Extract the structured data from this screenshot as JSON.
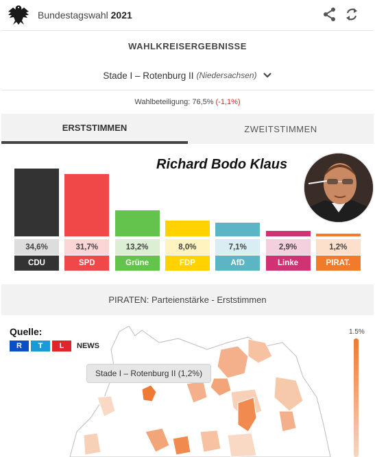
{
  "header": {
    "title_prefix": "Bundestagswahl",
    "title_year": "2021",
    "logo_icon": "federal-eagle-icon",
    "share_icon": "share-icon",
    "refresh_icon": "refresh-icon"
  },
  "section": {
    "title": "WAHLKREISERGEBNISSE"
  },
  "district": {
    "name": "Stade I – Rotenburg II",
    "state": "(Niedersachsen)",
    "dropdown_icon": "chevron-down-icon"
  },
  "turnout": {
    "label": "Wahlbeteiligung: 76,5%",
    "change": "(-1,1%)",
    "change_color": "#d22222"
  },
  "tabs": [
    {
      "label": "ERSTSTIMMEN",
      "active": true
    },
    {
      "label": "ZWEITSTIMMEN",
      "active": false
    }
  ],
  "overlay": {
    "name": "Richard Bodo Klaus",
    "photo_icon": "candidate-portrait"
  },
  "chart_data": {
    "type": "bar",
    "categories": [
      "CDU",
      "SPD",
      "Grüne",
      "FDP",
      "AfD",
      "Linke",
      "PIRAT."
    ],
    "values": [
      34.6,
      31.7,
      13.2,
      8.0,
      7.1,
      2.9,
      1.2
    ],
    "value_labels": [
      "34,6%",
      "31,7%",
      "13,2%",
      "8,0%",
      "7,1%",
      "2,9%",
      "1,2%"
    ],
    "colors": [
      "#333333",
      "#f04848",
      "#63c34c",
      "#ffd200",
      "#5bb5c5",
      "#d13274",
      "#f17a2b"
    ],
    "value_bg": [
      "#dddddd",
      "#fcd6d6",
      "#dcefd5",
      "#fff4c0",
      "#d9eef2",
      "#f4cfde",
      "#fde0cc"
    ],
    "ylim": [
      0,
      35
    ]
  },
  "map": {
    "title": "PIRATEN: Parteienstärke - Erststimmen",
    "source_label": "Quelle:",
    "source_letters": [
      "R",
      "T",
      "L"
    ],
    "source_news": "NEWS",
    "tooltip": "Stade I – Rotenburg II (1,2%)",
    "legend_max": "1.5%",
    "legend_color": "#ee7a35"
  }
}
